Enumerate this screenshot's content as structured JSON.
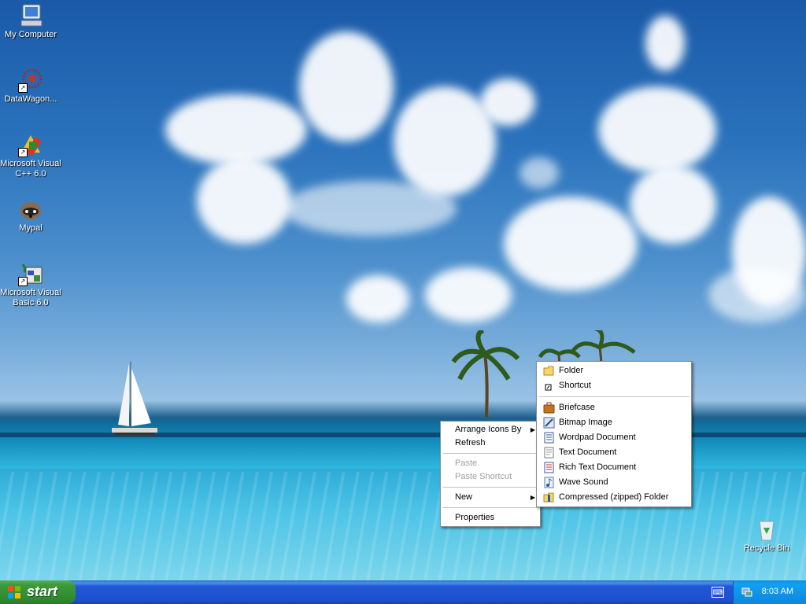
{
  "desktop_icons": [
    {
      "label": "My Computer",
      "icon": "my-computer-icon"
    },
    {
      "label": "DataWagon...",
      "icon": "datawagon-icon"
    },
    {
      "label": "Microsoft Visual C++ 6.0",
      "icon": "visual-cpp-icon"
    },
    {
      "label": "Mypal",
      "icon": "mypal-icon"
    },
    {
      "label": "Microsoft Visual Basic 6.0",
      "icon": "visual-basic-icon"
    },
    {
      "label": "Recycle Bin",
      "icon": "recycle-bin-icon"
    }
  ],
  "context_menu": {
    "arrange": "Arrange Icons By",
    "refresh": "Refresh",
    "paste": "Paste",
    "paste_shortcut": "Paste Shortcut",
    "new": "New",
    "properties": "Properties"
  },
  "new_submenu": {
    "items": [
      {
        "label": "Folder",
        "icon": "folder-icon"
      },
      {
        "label": "Shortcut",
        "icon": "shortcut-icon"
      },
      {
        "label": "Briefcase",
        "icon": "briefcase-icon"
      },
      {
        "label": "Bitmap Image",
        "icon": "bitmap-icon"
      },
      {
        "label": "Wordpad Document",
        "icon": "wordpad-icon"
      },
      {
        "label": "Text Document",
        "icon": "text-document-icon"
      },
      {
        "label": "Rich Text Document",
        "icon": "rich-text-icon"
      },
      {
        "label": "Wave Sound",
        "icon": "wave-sound-icon"
      },
      {
        "label": "Compressed (zipped) Folder",
        "icon": "zip-folder-icon"
      }
    ]
  },
  "taskbar": {
    "start_label": "start",
    "time": "8:03 AM"
  },
  "colors": {
    "taskbar_blue": "#245edb",
    "start_green": "#3c9a3a",
    "tray_blue": "#0f8ae8"
  }
}
